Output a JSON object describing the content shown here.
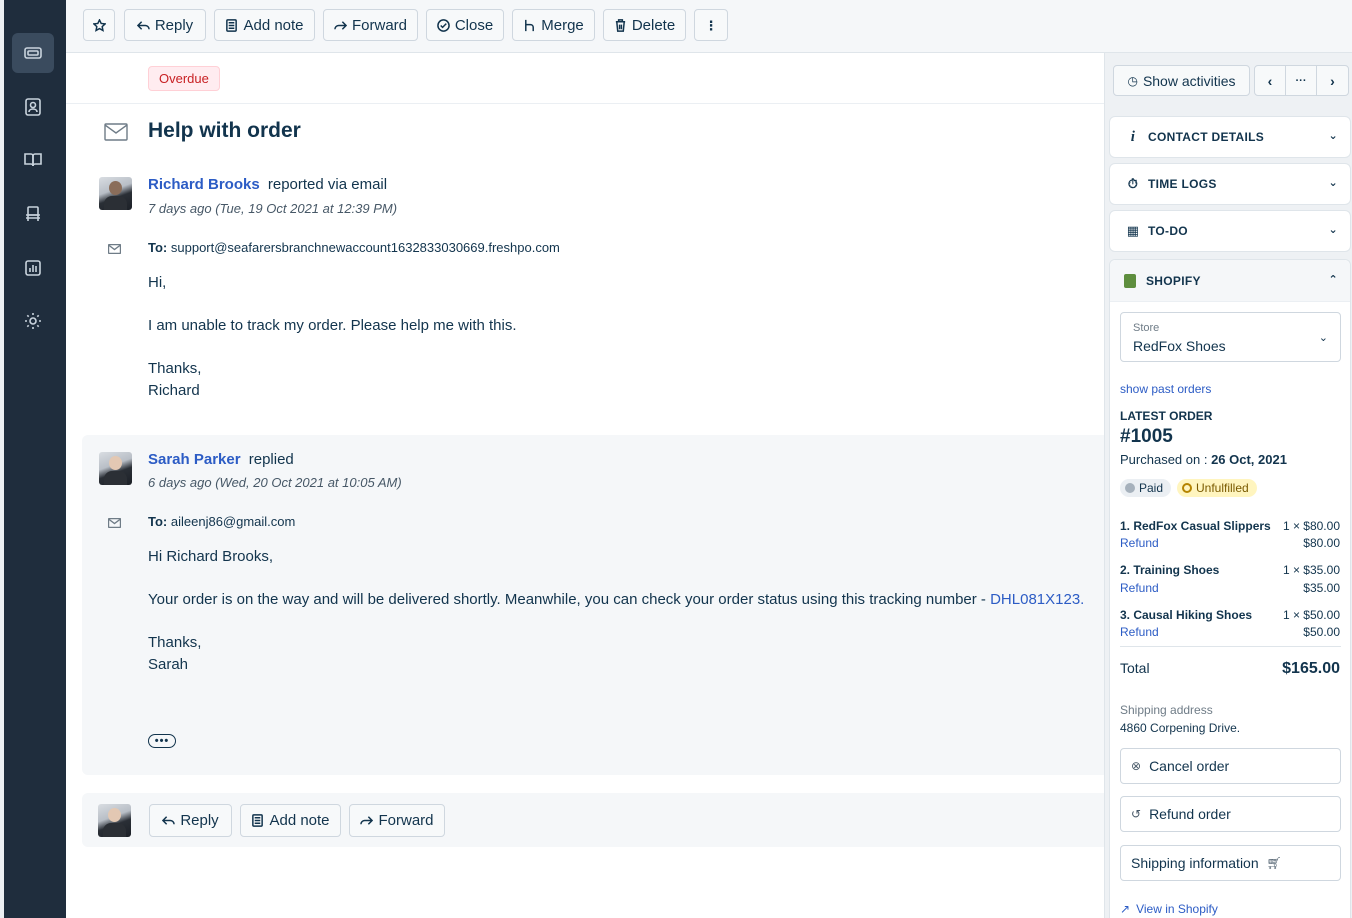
{
  "toolbar": {
    "reply": "Reply",
    "add_note": "Add note",
    "forward": "Forward",
    "close": "Close",
    "merge": "Merge",
    "delete": "Delete"
  },
  "ticket": {
    "status_badge": "Overdue",
    "subject": "Help with order"
  },
  "messages": [
    {
      "sender": "Richard Brooks",
      "action": "reported via email",
      "time": "7 days ago (Tue, 19 Oct 2021 at 12:39 PM)",
      "to_label": "To:",
      "to": "support@seafarersbranchnewaccount1632833030669.freshpo.com",
      "lines": [
        "Hi,",
        "I am unable to track my order. Please help me with this.",
        "Thanks,",
        "Richard"
      ]
    },
    {
      "sender": "Sarah Parker",
      "action": "replied",
      "time": "6 days ago (Wed, 20 Oct 2021 at 10:05 AM)",
      "to_label": "To:",
      "to": "aileenj86@gmail.com",
      "lines": [
        "Hi Richard Brooks,",
        "Your order is on the way and will be delivered shortly. Meanwhile, you can check your order status using this tracking number - ",
        "Thanks,",
        "Sarah"
      ],
      "tracking_number": "DHL081X123."
    }
  ],
  "bottom_bar": {
    "reply": "Reply",
    "add_note": "Add note",
    "forward": "Forward"
  },
  "sidebar": {
    "show_activities": "Show activities",
    "panels": [
      "CONTACT DETAILS",
      "TIME LOGS",
      "TO-DO"
    ],
    "shopify": {
      "title": "SHOPIFY",
      "store_label": "Store",
      "store_value": "RedFox Shoes",
      "past_orders_link": "show past orders",
      "latest_order_label": "LATEST ORDER",
      "order_number": "#1005",
      "purchased_label": "Purchased on : ",
      "purchased_date": "26 Oct, 2021",
      "paid_badge": "Paid",
      "fulfillment_badge": "Unfulfilled",
      "items": [
        {
          "name": "1. RedFox Casual Slippers",
          "qty": "1  ×  $80.00",
          "total": "$80.00",
          "refund": "Refund"
        },
        {
          "name": "2. Training Shoes",
          "qty": "1  ×  $35.00",
          "total": "$35.00",
          "refund": "Refund"
        },
        {
          "name": "3. Causal Hiking Shoes",
          "qty": "1  ×  $50.00",
          "total": "$50.00",
          "refund": "Refund"
        }
      ],
      "total_label": "Total",
      "total_value": "$165.00",
      "shipping_label": "Shipping address",
      "shipping_value": "4860 Corpening Drive.",
      "cancel_order": "Cancel order",
      "refund_order": "Refund order",
      "shipping_information": "Shipping information",
      "view_in_shopify": "View in Shopify"
    }
  },
  "colors": {
    "nav_bg": "#1f2d3d",
    "link": "#2c5cc5",
    "overdue": "#c82124"
  }
}
